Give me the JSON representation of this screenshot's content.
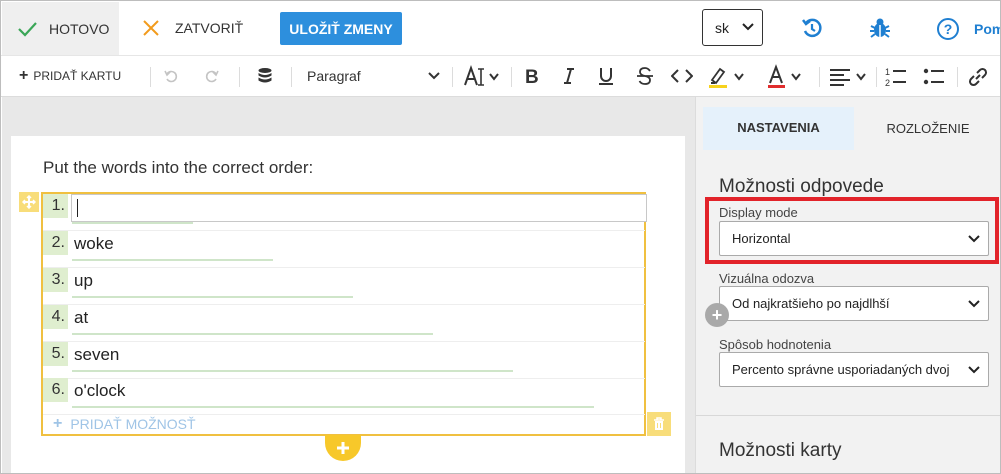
{
  "topbar": {
    "hotovo_label": "HOTOVO",
    "zatvorit_label": "ZATVORIŤ",
    "ulozit_label": "ULOŽIŤ ZMENY",
    "language": "sk",
    "help_label": "Pom"
  },
  "toolbar": {
    "add_card_label": "PRIDAŤ KARTU",
    "paragraph_style": "Paragraf"
  },
  "editor": {
    "question": "Put the words into the correct order:",
    "options": [
      {
        "num": "1.",
        "text": "I"
      },
      {
        "num": "2.",
        "text": "woke"
      },
      {
        "num": "3.",
        "text": "up"
      },
      {
        "num": "4.",
        "text": "at"
      },
      {
        "num": "5.",
        "text": "seven"
      },
      {
        "num": "6.",
        "text": "o'clock"
      }
    ],
    "add_option_label": "PRIDAŤ MOŽNOSŤ"
  },
  "panel": {
    "tabs": [
      {
        "label": "NASTAVENIA",
        "active": true
      },
      {
        "label": "ROZLOŽENIE",
        "active": false
      }
    ],
    "section_title": "Možnosti odpovede",
    "display_mode": {
      "label": "Display mode",
      "value": "Horizontal"
    },
    "visual_feedback": {
      "label": "Vizuálna odozva",
      "value": "Od najkratšieho po najdlhší"
    },
    "scoring": {
      "label": "Spôsob hodnotenia",
      "value": "Percento správne usporiadaných dvoj"
    },
    "section_title_2": "Možnosti karty"
  },
  "colors": {
    "primary_button": "#2d8fdd",
    "link_blue": "#1f7fd1",
    "selection_yellow": "#f0c040",
    "highlight_red": "#e2232a",
    "check_green": "#3aa657",
    "close_orange": "#f29b1d"
  }
}
